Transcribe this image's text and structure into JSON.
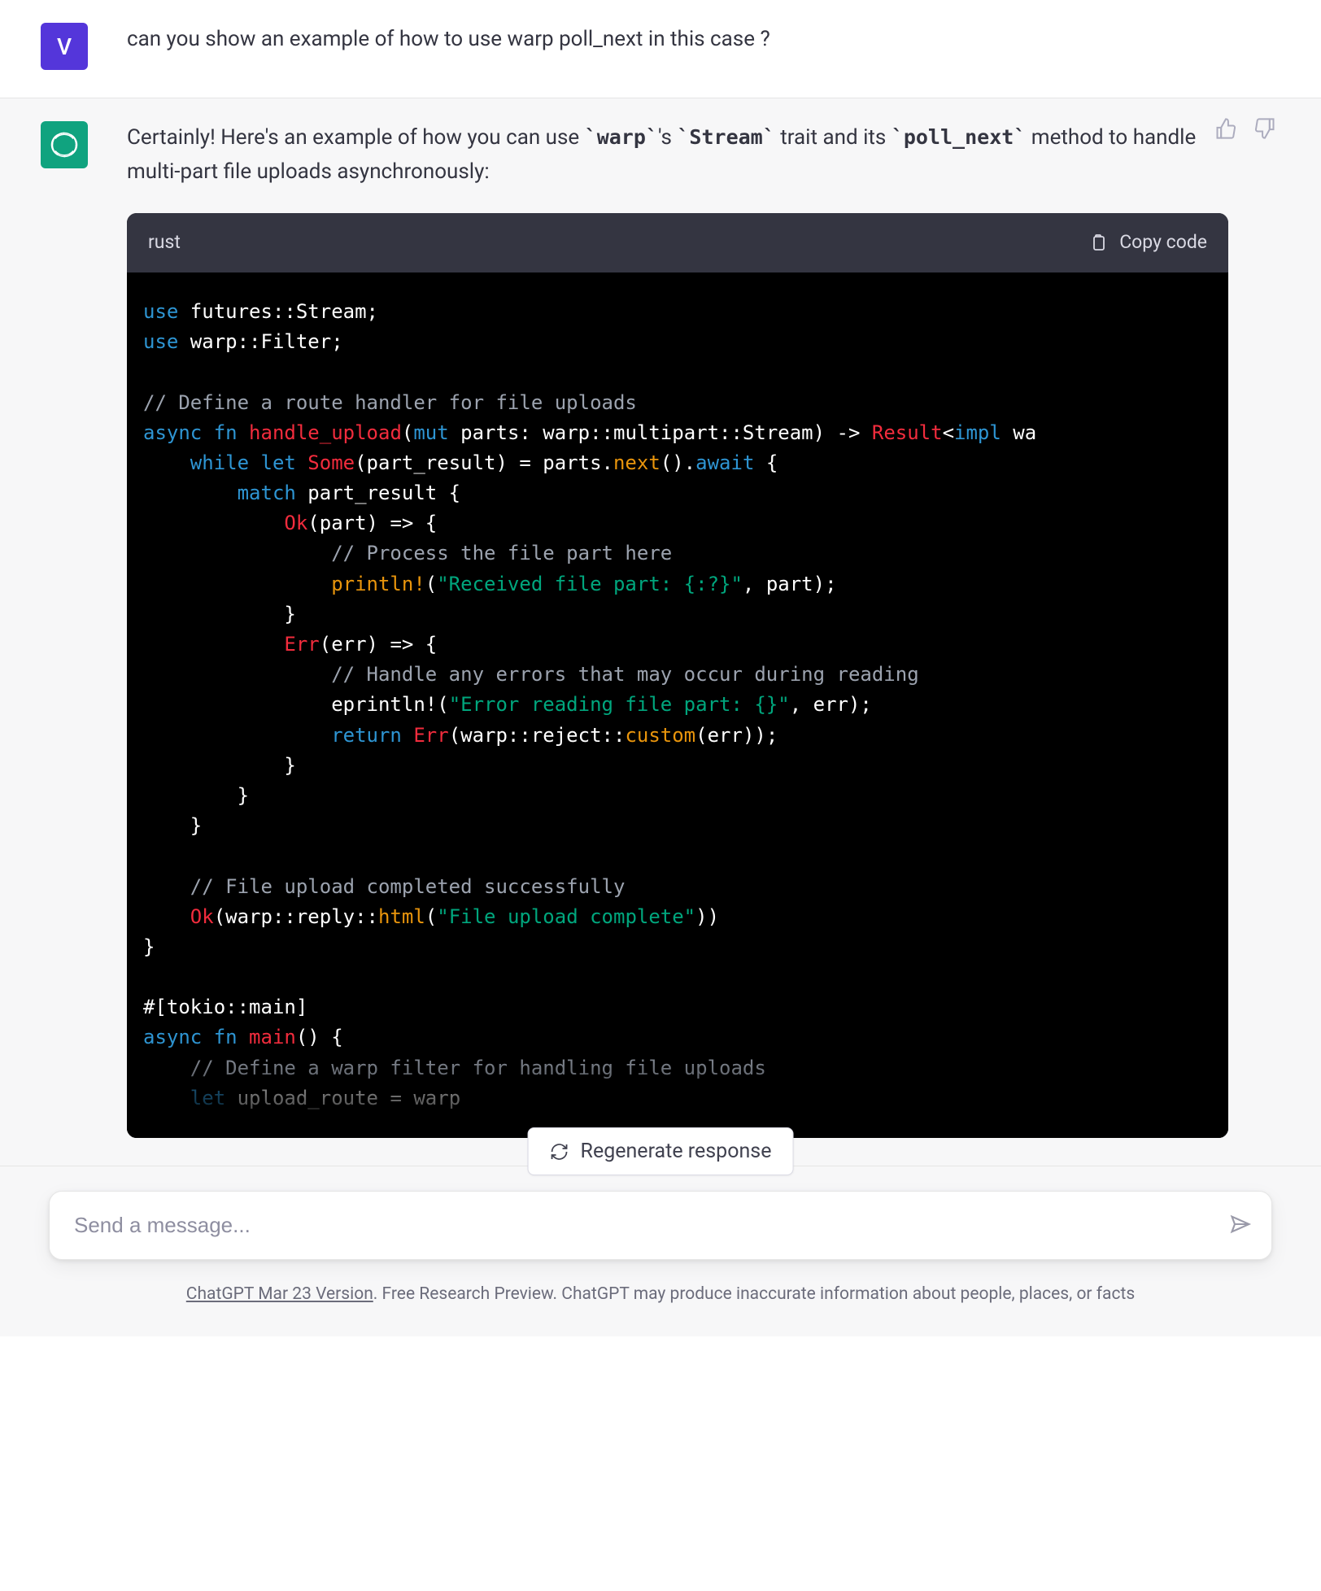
{
  "user": {
    "avatar_letter": "V",
    "question": "can you show an example of how to use warp poll_next in this case ?"
  },
  "assistant": {
    "intro_pre": "Certainly! Here's an example of how you can use ",
    "code1": "`warp`",
    "intro_mid1": "'s ",
    "code2": "`Stream`",
    "intro_mid2": " trait and its ",
    "code3": "`poll_next`",
    "intro_post": " method to handle multi-part file uploads asynchronously:"
  },
  "codeblock": {
    "lang": "rust",
    "copy_label": "Copy code"
  },
  "code": {
    "l01a": "use",
    "l01b": " futures::Stream;",
    "l02a": "use",
    "l02b": " warp::Filter;",
    "blank": "",
    "l03": "// Define a route handler for file uploads",
    "l04a": "async",
    "l04b": " fn ",
    "l04c": "handle_upload",
    "l04d": "(",
    "l04e": "mut",
    "l04f": " parts: warp::multipart::Stream) -> ",
    "l04g": "Result",
    "l04h": "<",
    "l04i": "impl",
    "l04j": " wa",
    "l05a": "    while",
    "l05b": " let ",
    "l05c": "Some",
    "l05d": "(part_result) = parts.",
    "l05e": "next",
    "l05f": "().",
    "l05g": "await",
    "l05h": " {",
    "l06a": "        match",
    "l06b": " part_result {",
    "l07a": "            Ok",
    "l07b": "(part) => {",
    "l08": "                // Process the file part here",
    "l09a": "                println!",
    "l09b": "(",
    "l09c": "\"Received file part: {:?}\"",
    "l09d": ", part);",
    "l10": "            }",
    "l11a": "            Err",
    "l11b": "(err) => {",
    "l12": "                // Handle any errors that may occur during reading",
    "l13a": "                eprintln!(",
    "l13b": "\"Error reading file part: {}\"",
    "l13c": ", err);",
    "l14a": "                return",
    "l14b": " Err",
    "l14c": "(warp::reject::",
    "l14d": "custom",
    "l14e": "(err));",
    "l15": "            }",
    "l16": "        }",
    "l17": "    }",
    "blank2": "",
    "l18": "    // File upload completed successfully",
    "l19a": "    Ok",
    "l19b": "(warp::reply::",
    "l19c": "html",
    "l19d": "(",
    "l19e": "\"File upload complete\"",
    "l19f": "))",
    "l20": "}",
    "blank3": "",
    "l21": "#[tokio::main]",
    "l22a": "async",
    "l22b": " fn ",
    "l22c": "main",
    "l22d": "() {",
    "l23": "    // Define a warp filter for handling file uploads",
    "l24a": "    let",
    "l24b": " upload_route = warp"
  },
  "regen_label": "Regenerate response",
  "input_placeholder": "Send a message...",
  "footer": {
    "link": "ChatGPT Mar 23 Version",
    "rest": ". Free Research Preview. ChatGPT may produce inaccurate information about people, places, or facts"
  }
}
